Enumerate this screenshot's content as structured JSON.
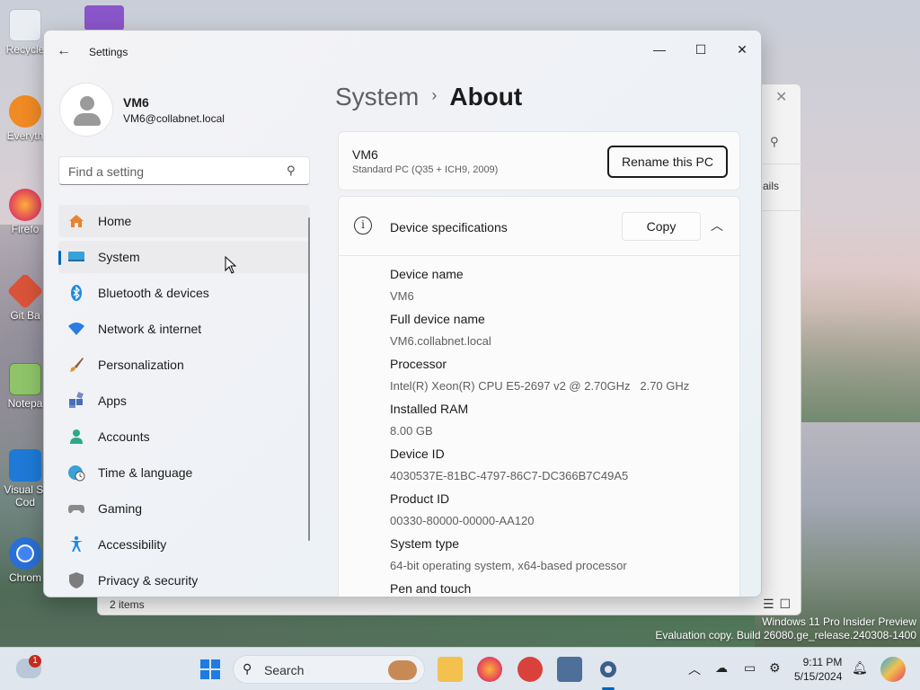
{
  "desktop": {
    "icons": [
      {
        "label": "Recycle",
        "icon": "recycle-bin-icon"
      },
      {
        "label": "Everyth",
        "icon": "everything-search-icon"
      },
      {
        "label": "Firefo",
        "icon": "firefox-icon"
      },
      {
        "label": "Git Ba",
        "icon": "git-bash-icon"
      },
      {
        "label": "Notepa",
        "icon": "notepad-icon"
      },
      {
        "label": "Visual St Cod",
        "icon": "vscode-icon"
      },
      {
        "label": "Chrom",
        "icon": "chrome-icon"
      }
    ]
  },
  "explorer": {
    "details_label": "ails",
    "status": "2 items"
  },
  "settings": {
    "app_title": "Settings",
    "profile": {
      "name": "VM6",
      "email": "VM6@collabnet.local"
    },
    "search_placeholder": "Find a setting",
    "nav": [
      {
        "label": "Home",
        "icon": "home-icon",
        "color": "#e8832f"
      },
      {
        "label": "System",
        "icon": "system-display-icon",
        "color": "#3aa0d8"
      },
      {
        "label": "Bluetooth & devices",
        "icon": "bluetooth-icon",
        "color": "#1f8be0"
      },
      {
        "label": "Network & internet",
        "icon": "wifi-icon",
        "color": "#2b7de1"
      },
      {
        "label": "Personalization",
        "icon": "brush-icon",
        "color": "#e0902e"
      },
      {
        "label": "Apps",
        "icon": "apps-icon",
        "color": "#4a6fb4"
      },
      {
        "label": "Accounts",
        "icon": "accounts-icon",
        "color": "#2ca889"
      },
      {
        "label": "Time & language",
        "icon": "globe-clock-icon",
        "color": "#3aa0d8"
      },
      {
        "label": "Gaming",
        "icon": "gamepad-icon",
        "color": "#7d7d7d"
      },
      {
        "label": "Accessibility",
        "icon": "accessibility-icon",
        "color": "#1f8be0"
      },
      {
        "label": "Privacy & security",
        "icon": "shield-icon",
        "color": "#7d7d7d"
      }
    ],
    "selected_nav": "System",
    "breadcrumb": {
      "parent": "System",
      "current": "About"
    },
    "pc": {
      "name": "VM6",
      "model": "Standard PC (Q35 + ICH9, 2009)",
      "rename_label": "Rename this PC"
    },
    "specs": {
      "title": "Device specifications",
      "copy_label": "Copy",
      "rows": [
        {
          "label": "Device name",
          "value": "VM6"
        },
        {
          "label": "Full device name",
          "value": "VM6.collabnet.local"
        },
        {
          "label": "Processor",
          "value": "Intel(R) Xeon(R) CPU E5-2697 v2 @ 2.70GHz   2.70 GHz"
        },
        {
          "label": "Installed RAM",
          "value": "8.00 GB"
        },
        {
          "label": "Device ID",
          "value": "4030537E-81BC-4797-86C7-DC366B7C49A5"
        },
        {
          "label": "Product ID",
          "value": "00330-80000-00000-AA120"
        },
        {
          "label": "System type",
          "value": "64-bit operating system, x64-based processor"
        },
        {
          "label": "Pen and touch",
          "value": ""
        }
      ]
    }
  },
  "watermark": {
    "line1": "Windows 11 Pro Insider Preview",
    "line2": "Evaluation copy. Build 26080.ge_release.240308-1400"
  },
  "taskbar": {
    "search_label": "Search",
    "notification_count": "1",
    "time": "9:11 PM",
    "date": "5/15/2024"
  }
}
